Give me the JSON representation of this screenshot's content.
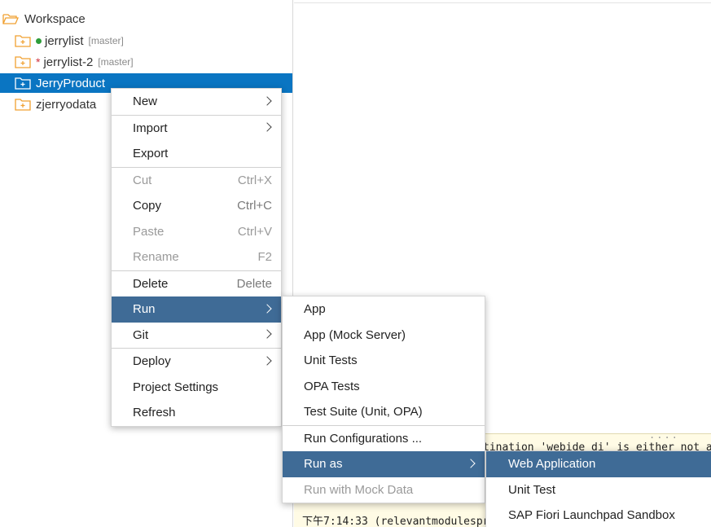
{
  "tree": {
    "root_label": "Workspace",
    "items": [
      {
        "label": "jerrylist",
        "branch": "[master]",
        "marker": "dot"
      },
      {
        "label": "jerrylist-2",
        "branch": "[master]",
        "marker": "star"
      },
      {
        "label": "JerryProduct",
        "branch": "",
        "marker": "none",
        "selected": true
      },
      {
        "label": "zjerryodata",
        "branch": "",
        "marker": "none"
      }
    ],
    "star_char": "*"
  },
  "context_menu": {
    "items": [
      {
        "label": "New",
        "submenu": true
      },
      {
        "label": "Import",
        "submenu": true
      },
      {
        "label": "Export"
      },
      {
        "label": "Cut",
        "shortcut": "Ctrl+X",
        "disabled": true
      },
      {
        "label": "Copy",
        "shortcut": "Ctrl+C"
      },
      {
        "label": "Paste",
        "shortcut": "Ctrl+V",
        "disabled": true
      },
      {
        "label": "Rename",
        "shortcut": "F2",
        "disabled": true
      },
      {
        "label": "Delete",
        "shortcut": "Delete"
      },
      {
        "label": "Run",
        "submenu": true,
        "active": true
      },
      {
        "label": "Git",
        "submenu": true
      },
      {
        "label": "Deploy",
        "submenu": true
      },
      {
        "label": "Project Settings"
      },
      {
        "label": "Refresh"
      }
    ]
  },
  "run_submenu": {
    "items": [
      {
        "label": "App"
      },
      {
        "label": "App (Mock Server)"
      },
      {
        "label": "Unit Tests"
      },
      {
        "label": "OPA Tests"
      },
      {
        "label": "Test Suite (Unit, OPA)"
      },
      {
        "label": "Run Configurations ..."
      },
      {
        "label": "Run as",
        "submenu": true,
        "active": true
      },
      {
        "label": "Run with Mock Data",
        "disabled": true
      }
    ]
  },
  "run_as_submenu": {
    "items": [
      {
        "label": "Web Application",
        "active": true
      },
      {
        "label": "Unit Test"
      },
      {
        "label": "SAP Fiori Launchpad Sandbox"
      }
    ]
  },
  "console": {
    "dots": "....",
    "line1": "tination 'webide_di' is either not a",
    "line3": "下午7:14:33 (relevantmodulespr"
  },
  "colors": {
    "selection": "#0a75c2",
    "menu_active": "#3f6b96",
    "folder": "#f0a030",
    "git_dot": "#2e9d3a",
    "git_star": "#d0323e",
    "console_bg": "#fffbe5"
  }
}
